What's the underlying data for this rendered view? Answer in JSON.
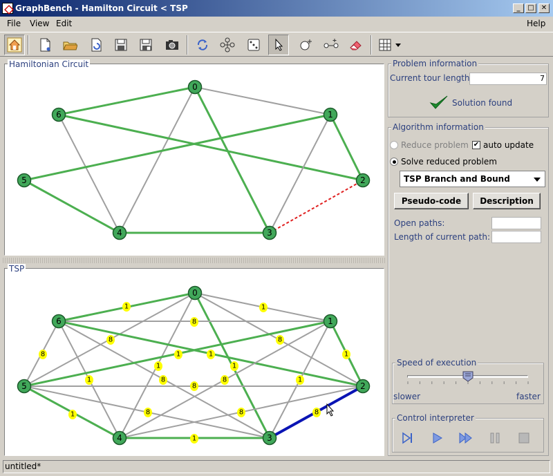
{
  "window": {
    "title": "GraphBench - Hamilton Circuit < TSP",
    "minimize": "_",
    "maximize": "□",
    "close": "✕"
  },
  "menu": {
    "file": "File",
    "view": "View",
    "edit": "Edit",
    "help": "Help"
  },
  "toolbar": {
    "icons": [
      "home-icon",
      "new-graph-icon",
      "open-folder-icon",
      "reload-icon",
      "save-icon",
      "save-as-icon",
      "snapshot-camera-icon",
      "refresh-cycle-icon",
      "layout-graph-icon",
      "random-dice-icon",
      "select-pointer-icon",
      "add-node-icon",
      "add-edge-icon",
      "eraser-icon",
      "grid-icon",
      "dropdown-arrow-icon"
    ]
  },
  "graphs": {
    "hamiltonian": {
      "title": "Hamiltonian Circuit",
      "nodes": [
        {
          "id": "0",
          "label": "0"
        },
        {
          "id": "1",
          "label": "1"
        },
        {
          "id": "2",
          "label": "2"
        },
        {
          "id": "3",
          "label": "3"
        },
        {
          "id": "4",
          "label": "4"
        },
        {
          "id": "5",
          "label": "5"
        },
        {
          "id": "6",
          "label": "6"
        }
      ]
    },
    "tsp": {
      "title": "TSP",
      "nodes": [
        {
          "id": "0",
          "label": "0"
        },
        {
          "id": "1",
          "label": "1"
        },
        {
          "id": "2",
          "label": "2"
        },
        {
          "id": "3",
          "label": "3"
        },
        {
          "id": "4",
          "label": "4"
        },
        {
          "id": "5",
          "label": "5"
        },
        {
          "id": "6",
          "label": "6"
        }
      ],
      "weight_labels": [
        "1",
        "1",
        "8",
        "8",
        "8",
        "8",
        "1",
        "1",
        "1",
        "1",
        "1",
        "1",
        "8",
        "8",
        "8",
        "1",
        "8",
        "8",
        "1",
        "1",
        "8"
      ]
    }
  },
  "problem": {
    "title": "Problem information",
    "tour_length_label": "Current tour length:",
    "tour_length_value": "7",
    "solution_status": "Solution found"
  },
  "algorithm": {
    "title": "Algorithm information",
    "reduce_label": "Reduce problem",
    "auto_update_label": "auto update",
    "auto_update_checked": "✔",
    "solve_label": "Solve reduced problem",
    "selected_algorithm": "TSP Branch and Bound",
    "pseudo_code_button": "Pseudo-code",
    "description_button": "Description",
    "open_paths_label": "Open paths:",
    "open_paths_value": "",
    "current_path_length_label": "Length of current path:",
    "current_path_length_value": ""
  },
  "speed": {
    "title": "Speed of execution",
    "slower": "slower",
    "faster": "faster",
    "level": 0.5
  },
  "interpreter": {
    "title": "Control interpreter"
  },
  "status": {
    "text": "untitled*"
  },
  "colors": {
    "node_fill": "#41a85a",
    "tour_edge": "#4caf50",
    "plain_edge": "#a0a0a0",
    "dashed_edge": "#e02020",
    "highlight_edge": "#0a14b4",
    "weight_fill": "#ffff00",
    "label_blue": "#2b3f7e"
  }
}
